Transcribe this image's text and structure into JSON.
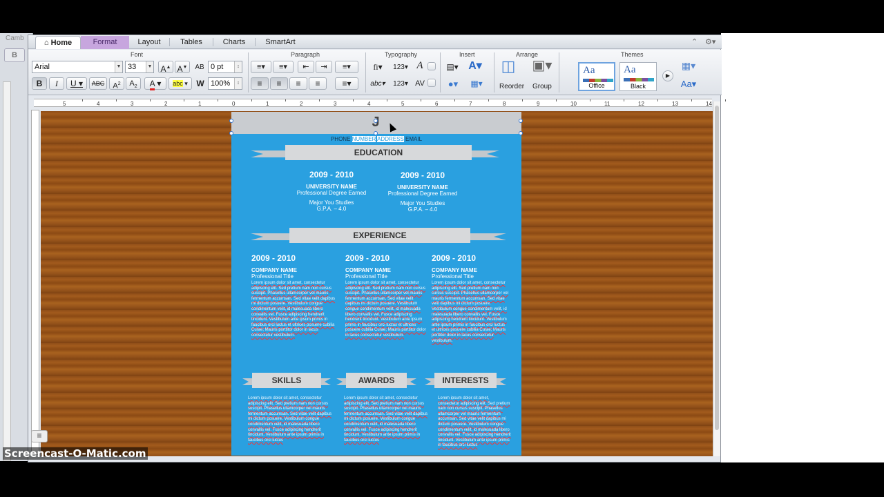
{
  "bg_window": {
    "title_fragment": "Camb",
    "button_label": "B"
  },
  "tabs": [
    {
      "label": "Home"
    },
    {
      "label": "Format"
    },
    {
      "label": "Layout"
    },
    {
      "label": "Tables"
    },
    {
      "label": "Charts"
    },
    {
      "label": "SmartArt"
    }
  ],
  "groups": {
    "font": "Font",
    "paragraph": "Paragraph",
    "typography": "Typography",
    "insert": "Insert",
    "arrange": "Arrange",
    "themes": "Themes"
  },
  "font": {
    "name": "Arial",
    "size": "33",
    "spacing": "0 pt",
    "scale": "100%"
  },
  "arrange": {
    "reorder_label": "Reorder",
    "group_label": "Group"
  },
  "themes": [
    {
      "name": "Office",
      "sample": "Aa"
    },
    {
      "name": "Black",
      "sample": "Aa"
    }
  ],
  "ruler_numbers": [
    "5",
    "4",
    "3",
    "2",
    "1",
    "0",
    "1",
    "2",
    "3",
    "4",
    "5",
    "6",
    "7",
    "8",
    "9",
    "10",
    "11",
    "12",
    "13",
    "14"
  ],
  "resume": {
    "initial": "J",
    "contact": {
      "phone": "PHONE",
      "number": "NUMBER",
      "address": "ADDRESS",
      "email": "EMAIL"
    },
    "education": {
      "heading": "EDUCATION",
      "items": [
        {
          "years": "2009 - 2010",
          "school": "UNIVERSITY NAME",
          "degree": "Professional Degree Earned",
          "major": "Major You Studies",
          "gpa": "G.P.A. – 4.0"
        },
        {
          "years": "2009 - 2010",
          "school": "UNIVERSITY NAME",
          "degree": "Professional Degree Earned",
          "major": "Major You Studies",
          "gpa": "G.P.A. – 4.0"
        }
      ]
    },
    "experience": {
      "heading": "EXPERIENCE",
      "items": [
        {
          "years": "2009 - 2010",
          "company": "COMPANY NAME",
          "title": "Professional Title",
          "text": "Lorem ipsum dolor sit amet, consectetur adipiscing elit. Sed pretium nam non cursus suscipit. Phasellus ullamcorper vel mauris fermentum accumsan. Sed vitae velit dapibus mi dictum posuere. Vestibulum congue condimentum velit, id malesuada libero convallis vel. Fusce adipiscing hendrerit tincidunt. Vestibulum ante ipsum primis in faucibus orci luctus et ultrices posuere cubilia Curae; Mauris porttitor dolor in lacus consectetur vestibulum."
        },
        {
          "years": "2009 - 2010",
          "company": "COMPANY NAME",
          "title": "Professional Title",
          "text": "Lorem ipsum dolor sit amet, consectetur adipiscing elit. Sed pretium nam non cursus suscipit. Phasellus ullamcorper vel mauris fermentum accumsan. Sed vitae velit dapibus mi dictum posuere. Vestibulum congue condimentum velit, id malesuada libero convallis vel. Fusce adipiscing hendrerit tincidunt. Vestibulum ante ipsum primis in faucibus orci luctus et ultrices posuere cubilia Curae; Mauris porttitor dolor in lacus consectetur vestibulum."
        },
        {
          "years": "2009 - 2010",
          "company": "COMPANY NAME",
          "title": "Professional Title",
          "text": "Lorem ipsum dolor sit amet, consectetur adipiscing elit. Sed pretium nam non cursus suscipit. Phasellus ullamcorper vel mauris fermentum accumsan. Sed vitae velit dapibus mi dictum posuere. Vestibulum congue condimentum velit, id malesuada libero convallis vel. Fusce adipiscing hendrerit tincidunt. Vestibulum ante ipsum primis in faucibus orci luctus et ultrices posuere cubilia Curae; Mauris porttitor dolor in lacus consectetur vestibulum."
        }
      ]
    },
    "bottom": [
      {
        "heading": "SKILLS",
        "text": "Lorem ipsum dolor sit amet, consectetur adipiscing elit. Sed pretium nam non cursus suscipit. Phasellus ullamcorper vel mauris fermentum accumsan. Sed vitae velit dapibus mi dictum posuere. Vestibulum congue condimentum velit, id malesuada libero convallis vel. Fusce adipiscing hendrerit tincidunt. Vestibulum ante ipsum primis in faucibus orci luctus"
      },
      {
        "heading": "AWARDS",
        "text": "Lorem ipsum dolor sit amet, consectetur adipiscing elit. Sed pretium nam non cursus suscipit. Phasellus ullamcorper vel mauris fermentum accumsan. Sed vitae velit dapibus mi dictum posuere. Vestibulum congue condimentum velit, id malesuada libero convallis vel. Fusce adipiscing hendrerit tincidunt. Vestibulum ante ipsum primis in faucibus orci luctus"
      },
      {
        "heading": "INTERESTS",
        "text": "Lorem ipsum dolor sit amet, consectetur adipiscing elit. Sed pretium nam non cursus suscipit. Phasellus ullamcorper vel mauris fermentum accumsan. Sed vitae velit dapibus mi dictum posuere. Vestibulum congue condimentum velit, id malesuada libero convallis vel. Fusce adipiscing hendrerit tincidunt. Vestibulum ante ipsum primis in faucibus orci luctus"
      }
    ]
  },
  "watermark": "Screencast-O-Matic.com",
  "colors": {
    "resume_blue": "#2aa0e0",
    "wood": "#9a5519",
    "format_tab": "#c7a6de"
  }
}
